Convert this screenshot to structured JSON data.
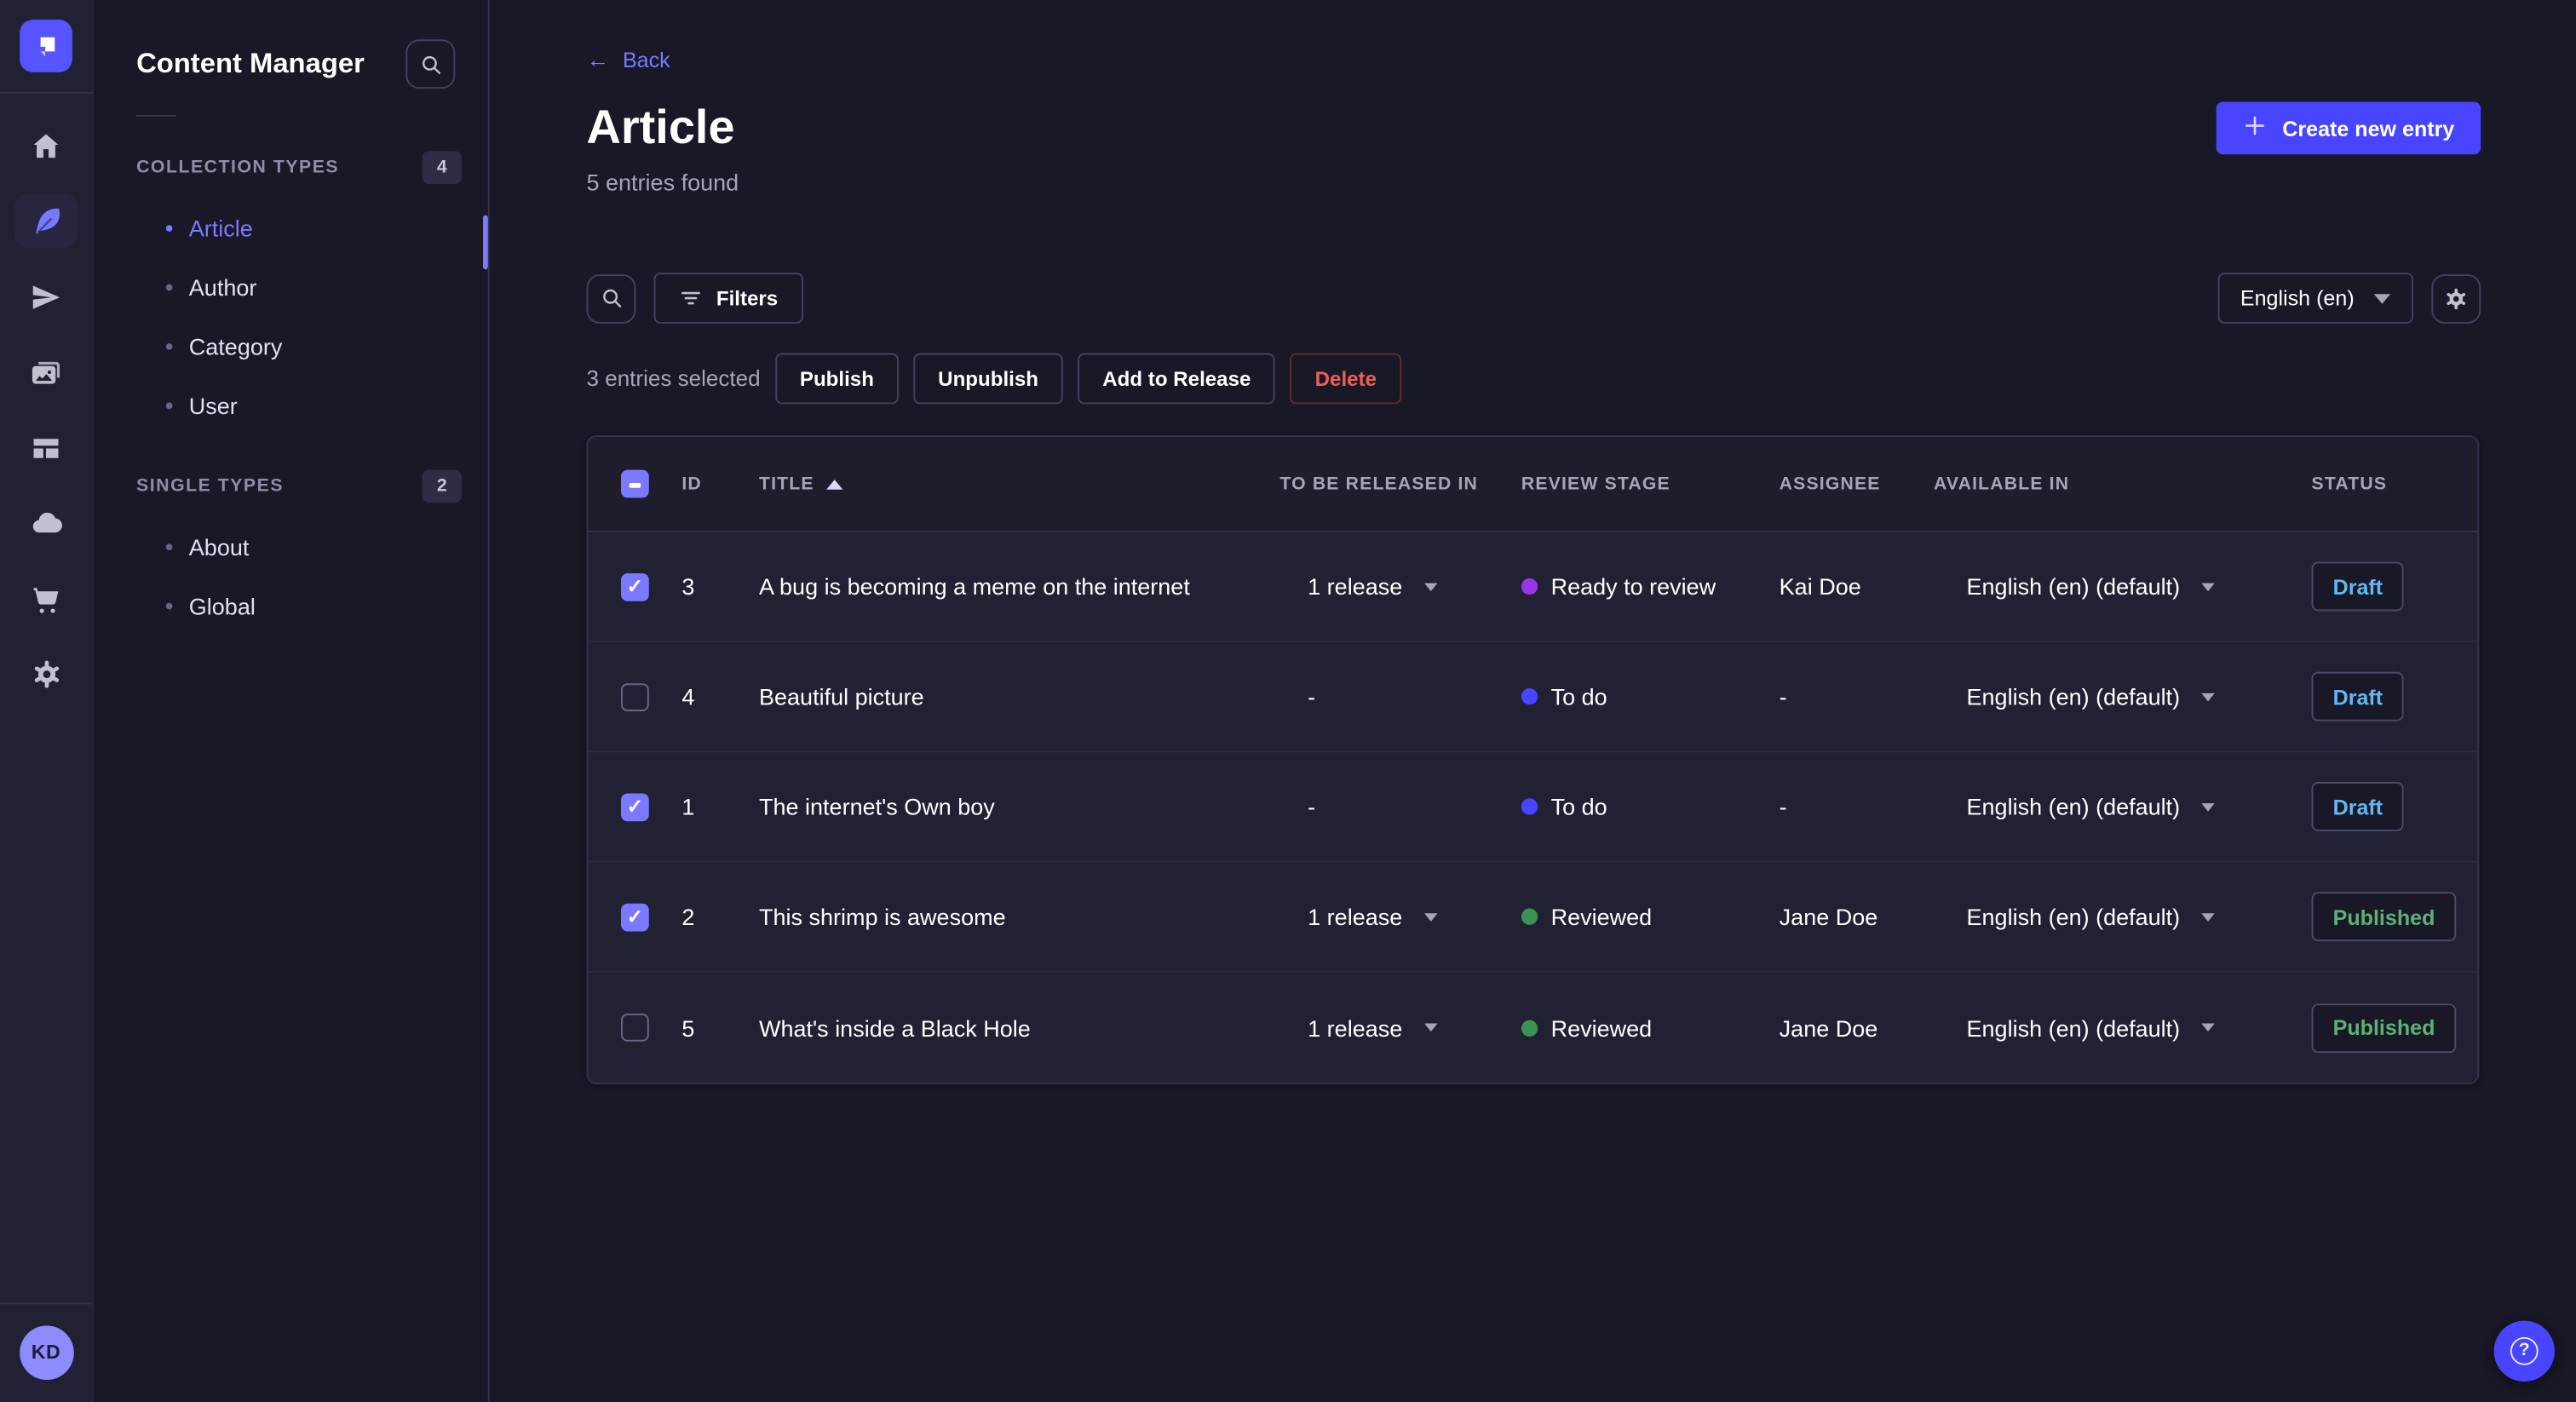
{
  "colors": {
    "primary": "#4945ff",
    "primary_light": "#7b79ff",
    "page_bg": "#181826",
    "surface": "#212134",
    "border": "#32324d"
  },
  "rail": {
    "icons": [
      "home",
      "content-manager",
      "releases",
      "media-library",
      "content-type-builder",
      "cloud",
      "marketplace",
      "settings"
    ],
    "active_icon": "content-manager",
    "avatar_initials": "KD"
  },
  "sidebar": {
    "title": "Content Manager",
    "sections": [
      {
        "label": "COLLECTION TYPES",
        "count": "4",
        "items": [
          {
            "label": "Article"
          },
          {
            "label": "Author"
          },
          {
            "label": "Category"
          },
          {
            "label": "User"
          }
        ]
      },
      {
        "label": "SINGLE TYPES",
        "count": "2",
        "items": [
          {
            "label": "About"
          },
          {
            "label": "Global"
          }
        ]
      }
    ],
    "active_item": "Article"
  },
  "header": {
    "back_label": "Back",
    "title": "Article",
    "subtitle": "5 entries found",
    "create_label": "Create new entry"
  },
  "toolbar": {
    "filters_label": "Filters",
    "locale_value": "English (en)"
  },
  "selection": {
    "label": "3 entries selected",
    "publish": "Publish",
    "unpublish": "Unpublish",
    "add_to_release": "Add to Release",
    "delete": "Delete"
  },
  "table": {
    "select_all_state": "mixed",
    "headers": {
      "id": "ID",
      "title": "TITLE",
      "release": "TO BE RELEASED IN",
      "review": "REVIEW STAGE",
      "assignee": "ASSIGNEE",
      "available": "AVAILABLE IN",
      "status": "STATUS"
    },
    "sorted_by": "TITLE",
    "sort_direction": "ascending",
    "rows": [
      {
        "checked": "true",
        "id": "3",
        "title": "A bug is becoming a meme on the internet",
        "release": "1 release",
        "release_caret": "true",
        "review": {
          "label": "Ready to review",
          "color": "#9736e8"
        },
        "assignee": "Kai Doe",
        "available": "English (en) (default)",
        "status": {
          "label": "Draft",
          "color": "#66b7f1"
        }
      },
      {
        "checked": "false",
        "id": "4",
        "title": "Beautiful picture",
        "release": "-",
        "release_caret": "false",
        "review": {
          "label": "To do",
          "color": "#4945ff"
        },
        "assignee": "-",
        "available": "English (en) (default)",
        "status": {
          "label": "Draft",
          "color": "#66b7f1"
        }
      },
      {
        "checked": "true",
        "id": "1",
        "title": "The internet's Own boy",
        "release": "-",
        "release_caret": "false",
        "review": {
          "label": "To do",
          "color": "#4945ff"
        },
        "assignee": "-",
        "available": "English (en) (default)",
        "status": {
          "label": "Draft",
          "color": "#66b7f1"
        }
      },
      {
        "checked": "true",
        "id": "2",
        "title": "This shrimp is awesome",
        "release": "1 release",
        "release_caret": "true",
        "review": {
          "label": "Reviewed",
          "color": "#3c9155"
        },
        "assignee": "Jane Doe",
        "available": "English (en) (default)",
        "status": {
          "label": "Published",
          "color": "#5cb176"
        }
      },
      {
        "checked": "false",
        "id": "5",
        "title": "What's inside a Black Hole",
        "release": "1 release",
        "release_caret": "true",
        "review": {
          "label": "Reviewed",
          "color": "#3c9155"
        },
        "assignee": "Jane Doe",
        "available": "English (en) (default)",
        "status": {
          "label": "Published",
          "color": "#5cb176"
        }
      }
    ]
  }
}
